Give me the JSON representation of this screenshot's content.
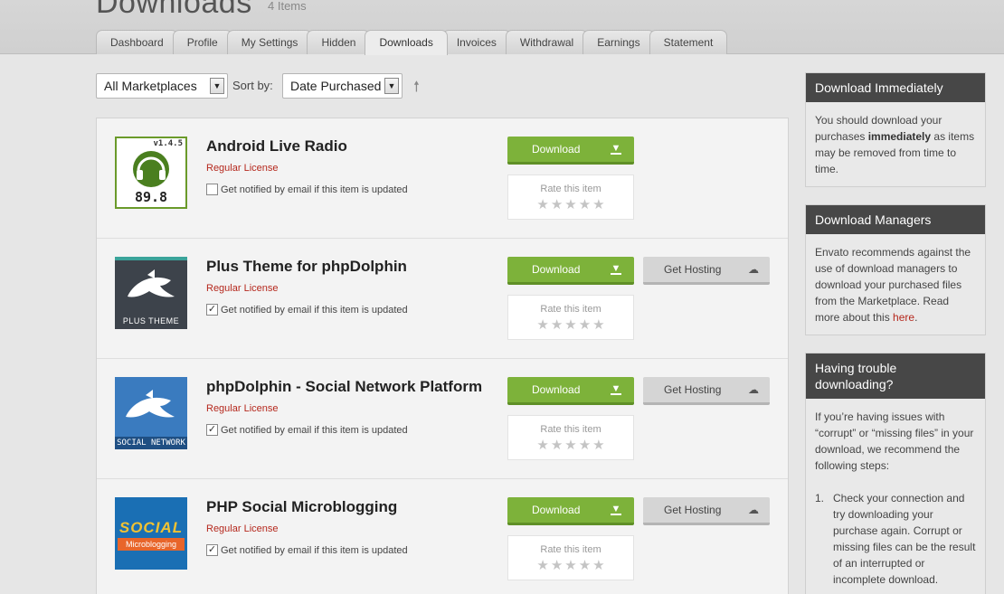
{
  "page": {
    "title": "Downloads",
    "item_count": "4 Items"
  },
  "tabs": [
    {
      "label": "Dashboard"
    },
    {
      "label": "Profile"
    },
    {
      "label": "My Settings"
    },
    {
      "label": "Hidden"
    },
    {
      "label": "Downloads",
      "active": true
    },
    {
      "label": "Invoices"
    },
    {
      "label": "Withdrawal"
    },
    {
      "label": "Earnings"
    },
    {
      "label": "Statement"
    }
  ],
  "filters": {
    "marketplace": "All Marketplaces",
    "sort_label": "Sort by:",
    "sort_value": "Date Purchased",
    "sort_direction_icon": "arrow-up-icon"
  },
  "common": {
    "license": "Regular License",
    "notify_label": "Get notified by email if this item is updated",
    "download_label": "Download",
    "rate_label": "Rate this item",
    "hosting_label": "Get Hosting"
  },
  "items": [
    {
      "title": "Android Live Radio",
      "thumb_text": "v1.4.5",
      "thumb_sub": "89.8",
      "notify_checked": false,
      "has_hosting": false
    },
    {
      "title": "Plus Theme for phpDolphin",
      "thumb_text": "PLUS THEME",
      "notify_checked": true,
      "has_hosting": true
    },
    {
      "title": "phpDolphin - Social Network Platform",
      "thumb_text": "SOCIAL NETWORK",
      "notify_checked": true,
      "has_hosting": true
    },
    {
      "title": "PHP Social Microblogging",
      "thumb_text": "SOCIAL",
      "thumb_sub": "Microblogging",
      "notify_checked": true,
      "has_hosting": true
    }
  ],
  "sidebar": {
    "immediately": {
      "title": "Download Immediately",
      "pre": "You should download your purchases ",
      "bold": "immediately",
      "post": " as items may be removed from time to time."
    },
    "managers": {
      "title": "Download Managers",
      "text": "Envato recommends against the use of download managers to download your purchased files from the Marketplace. Read more about this ",
      "link": "here",
      "tail": "."
    },
    "trouble": {
      "title": "Having trouble downloading?",
      "text": "If you’re having issues with “corrupt” or “missing files” in your download, we recommend the following steps:",
      "step_num": "1.",
      "step_text": "Check your connection and try downloading your purchase again. Corrupt or missing files can be the result of an interrupted or incomplete download."
    }
  },
  "colors": {
    "green": "#7db23a",
    "red_link": "#b5281d",
    "sidebar_head": "#474747"
  }
}
